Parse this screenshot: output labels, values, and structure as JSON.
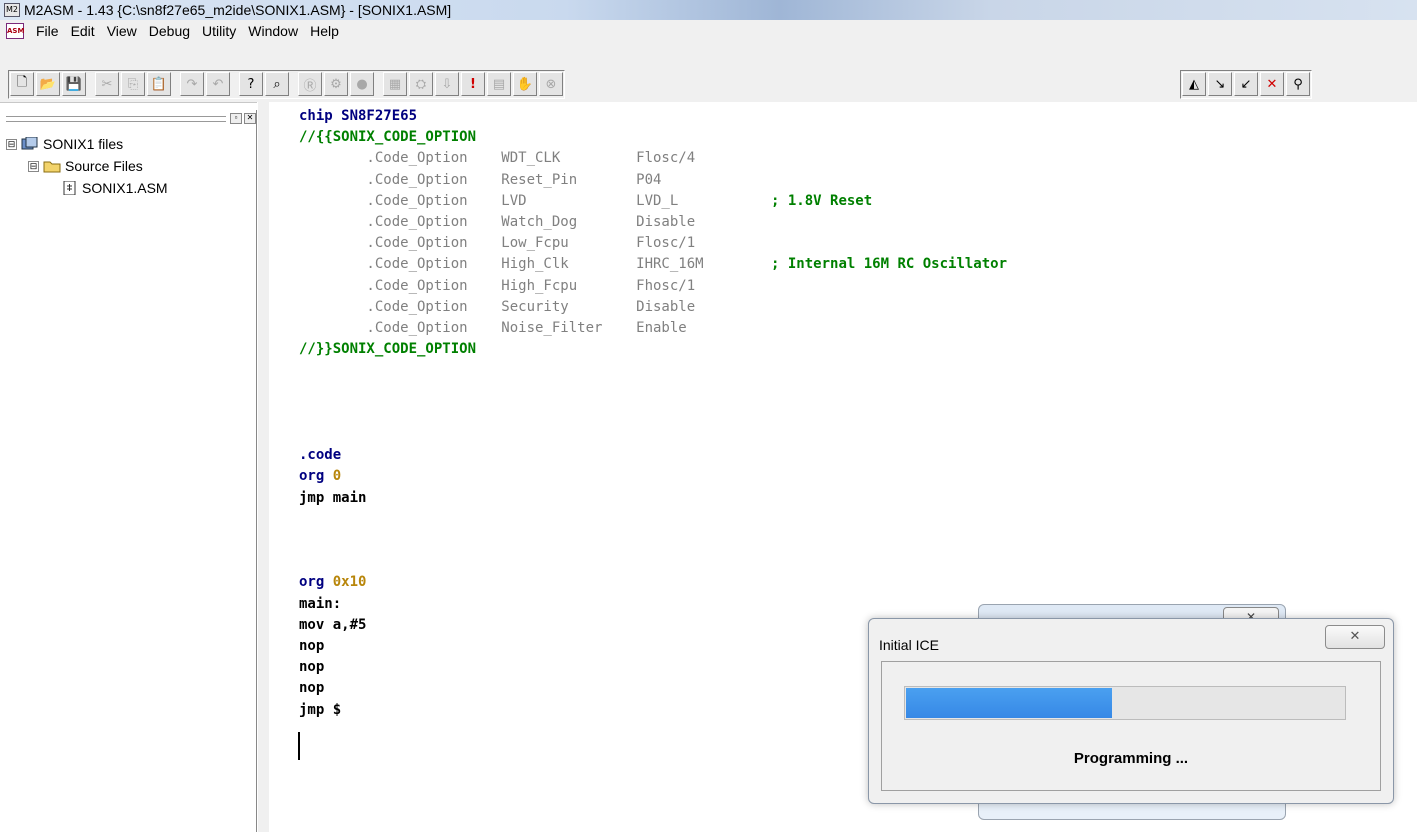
{
  "window": {
    "title": "M2ASM - 1.43 {C:\\sn8f27e65_m2ide\\SONIX1.ASM} - [SONIX1.ASM]",
    "app_icon": "asm-app-icon"
  },
  "menubar": {
    "items": [
      "File",
      "Edit",
      "View",
      "Debug",
      "Utility",
      "Window",
      "Help"
    ]
  },
  "toolbar": {
    "left_buttons": [
      {
        "name": "new-file-icon",
        "glyph": "🗋",
        "state": "enabled"
      },
      {
        "name": "open-folder-icon",
        "glyph": "📂",
        "state": "enabled"
      },
      {
        "name": "save-icon",
        "glyph": "💾",
        "state": "enabled"
      },
      {
        "name": "cut-icon",
        "glyph": "✂",
        "state": "disabled"
      },
      {
        "name": "copy-icon",
        "glyph": "⎘",
        "state": "disabled"
      },
      {
        "name": "paste-icon",
        "glyph": "📋",
        "state": "disabled"
      },
      {
        "name": "redo-icon",
        "glyph": "↷",
        "state": "disabled"
      },
      {
        "name": "undo-icon",
        "glyph": "↶",
        "state": "disabled"
      },
      {
        "name": "help-icon",
        "glyph": "?",
        "state": "enabled"
      },
      {
        "name": "find-icon",
        "glyph": "⌕",
        "state": "enabled"
      },
      {
        "name": "reset-icon",
        "glyph": "Ⓡ",
        "state": "disabled"
      },
      {
        "name": "gear-icon",
        "glyph": "⚙",
        "state": "disabled"
      },
      {
        "name": "stop-icon",
        "glyph": "●",
        "state": "disabled"
      },
      {
        "name": "build-icon",
        "glyph": "▦",
        "state": "disabled"
      },
      {
        "name": "compile-icon",
        "glyph": "⛭",
        "state": "disabled"
      },
      {
        "name": "download-icon",
        "glyph": "⇩",
        "state": "disabled"
      },
      {
        "name": "run-icon",
        "glyph": "!",
        "state": "red"
      },
      {
        "name": "step-icon",
        "glyph": "▤",
        "state": "disabled"
      },
      {
        "name": "hand-icon",
        "glyph": "✋",
        "state": "disabled"
      },
      {
        "name": "breakpoint-icon",
        "glyph": "⊗",
        "state": "disabled"
      }
    ],
    "right_buttons": [
      {
        "name": "bookmark-icon",
        "glyph": "◭",
        "state": "black"
      },
      {
        "name": "next-bookmark-icon",
        "glyph": "↘",
        "state": "black"
      },
      {
        "name": "prev-bookmark-icon",
        "glyph": "↙",
        "state": "black"
      },
      {
        "name": "clear-bookmarks-icon",
        "glyph": "✕",
        "state": "red"
      },
      {
        "name": "binoculars-icon",
        "glyph": "⚲",
        "state": "black"
      }
    ]
  },
  "tree": {
    "root": {
      "label": "SONIX1 files",
      "expander": "⊟"
    },
    "folder": {
      "label": "Source Files",
      "expander": "⊟"
    },
    "file": {
      "label": "SONIX1.ASM"
    }
  },
  "editor": {
    "lines": [
      {
        "segments": [
          {
            "t": "chip SN8F27E65",
            "c": "kw"
          }
        ]
      },
      {
        "segments": [
          {
            "t": "//{{SONIX_CODE_OPTION",
            "c": "green"
          }
        ]
      },
      {
        "segments": [
          {
            "t": "        .Code_Option    WDT_CLK         Flosc/4",
            "c": "gray"
          }
        ]
      },
      {
        "segments": [
          {
            "t": "        .Code_Option    Reset_Pin       P04",
            "c": "gray"
          }
        ]
      },
      {
        "segments": [
          {
            "t": "        .Code_Option    LVD             LVD_L           ",
            "c": "gray"
          },
          {
            "t": "; 1.8V Reset",
            "c": "comment"
          }
        ]
      },
      {
        "segments": [
          {
            "t": "        .Code_Option    Watch_Dog       Disable",
            "c": "gray"
          }
        ]
      },
      {
        "segments": [
          {
            "t": "        .Code_Option    Low_Fcpu        Flosc/1",
            "c": "gray"
          }
        ]
      },
      {
        "segments": [
          {
            "t": "        .Code_Option    High_Clk        IHRC_16M        ",
            "c": "gray"
          },
          {
            "t": "; Internal 16M RC Oscillator",
            "c": "comment"
          }
        ]
      },
      {
        "segments": [
          {
            "t": "        .Code_Option    High_Fcpu       Fhosc/1",
            "c": "gray"
          }
        ]
      },
      {
        "segments": [
          {
            "t": "        .Code_Option    Security        Disable",
            "c": "gray"
          }
        ]
      },
      {
        "segments": [
          {
            "t": "        .Code_Option    Noise_Filter    Enable",
            "c": "gray"
          }
        ]
      },
      {
        "segments": [
          {
            "t": "//}}SONIX_CODE_OPTION",
            "c": "green"
          }
        ]
      },
      {
        "segments": []
      },
      {
        "segments": []
      },
      {
        "segments": []
      },
      {
        "segments": []
      },
      {
        "segments": [
          {
            "t": ".code",
            "c": "kw"
          }
        ]
      },
      {
        "segments": [
          {
            "t": "org ",
            "c": "kw"
          },
          {
            "t": "0",
            "c": "num"
          }
        ]
      },
      {
        "segments": [
          {
            "t": "jmp main",
            "c": "blk2"
          }
        ]
      },
      {
        "segments": []
      },
      {
        "segments": []
      },
      {
        "segments": []
      },
      {
        "segments": [
          {
            "t": "org ",
            "c": "kw"
          },
          {
            "t": "0x10",
            "c": "num"
          }
        ]
      },
      {
        "segments": [
          {
            "t": "main:",
            "c": "blk2"
          }
        ]
      },
      {
        "segments": [
          {
            "t": "mov a,#5",
            "c": "blk2"
          }
        ]
      },
      {
        "segments": [
          {
            "t": "nop",
            "c": "blk2"
          }
        ]
      },
      {
        "segments": [
          {
            "t": "nop",
            "c": "blk2"
          }
        ]
      },
      {
        "segments": [
          {
            "t": "nop",
            "c": "blk2"
          }
        ]
      },
      {
        "segments": [
          {
            "t": "jmp $",
            "c": "blk2"
          }
        ]
      }
    ]
  },
  "dialog": {
    "title": "Initial ICE",
    "close_glyph": "✕",
    "status_text": "Programming ...",
    "progress_fraction": 0.47
  },
  "back_dialog": {
    "close_glyph": "✕"
  }
}
